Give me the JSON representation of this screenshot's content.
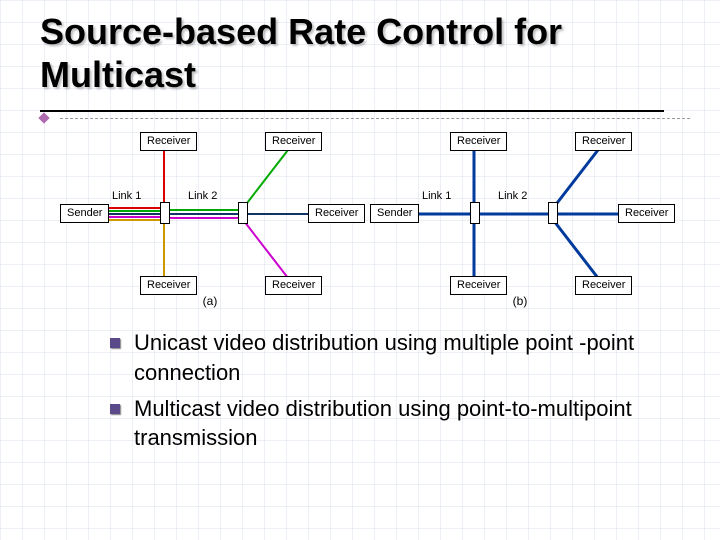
{
  "title": "Source-based Rate Control for Multicast",
  "diagramA": {
    "caption": "(a)",
    "sender": "Sender",
    "link1": "Link 1",
    "link2": "Link 2",
    "recv_top1": "Receiver",
    "recv_top2": "Receiver",
    "recv_mid": "Receiver",
    "recv_bot1": "Receiver",
    "recv_bot2": "Receiver",
    "line_colors": {
      "top1": "#d00",
      "top2": "#0a0",
      "mid": "#136",
      "bot1": "#c0c",
      "bot2": "#c90"
    }
  },
  "diagramB": {
    "caption": "(b)",
    "sender": "Sender",
    "link1": "Link 1",
    "link2": "Link 2",
    "recv_top1": "Receiver",
    "recv_top2": "Receiver",
    "recv_mid": "Receiver",
    "recv_bot1": "Receiver",
    "recv_bot2": "Receiver",
    "line_color": "#003a9d"
  },
  "bullets": [
    "Unicast video distribution using multiple point -point connection",
    "Multicast video distribution using point-to-multipoint transmission"
  ]
}
